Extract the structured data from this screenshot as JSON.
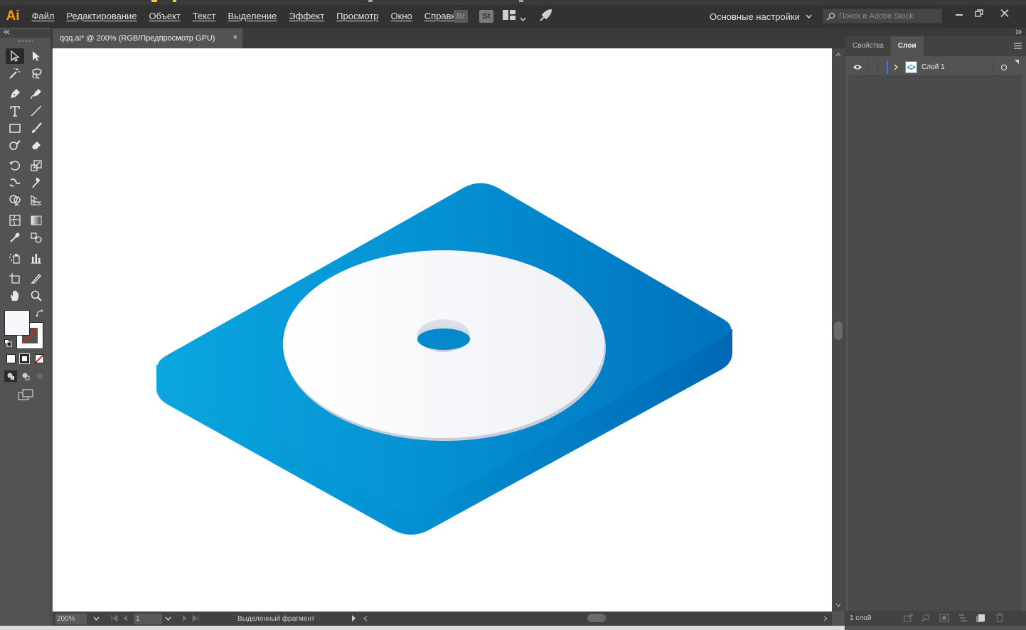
{
  "app": {
    "logo": "Ai",
    "menu": [
      "Файл",
      "Редактирование",
      "Объект",
      "Текст",
      "Выделение",
      "Эффект",
      "Просмотр",
      "Окно",
      "Справка"
    ],
    "bridge_label": "Br",
    "stock_label": "St",
    "workspace": "Основные настройки",
    "search_placeholder": "Поиск в Adobe Stock"
  },
  "document": {
    "tab_title": "qqq.ai* @ 200% (RGB/Предпросмотр GPU)",
    "close_glyph": "×"
  },
  "status": {
    "zoom": "200%",
    "artboard": "1",
    "tool_hint": "Выделенный фрагмент"
  },
  "panels": {
    "tabs": [
      "Свойства",
      "Слои"
    ],
    "active_tab": "Слои",
    "layer_name": "Слой 1",
    "layer_count": "1 слой"
  },
  "colors": {
    "accent_orange": "#ff9a00",
    "artwork_blue_light": "#0aa3dc",
    "artwork_blue_dark": "#0070bb",
    "layer_color": "#4f6bff",
    "disc_white": "#f4f6f9"
  }
}
